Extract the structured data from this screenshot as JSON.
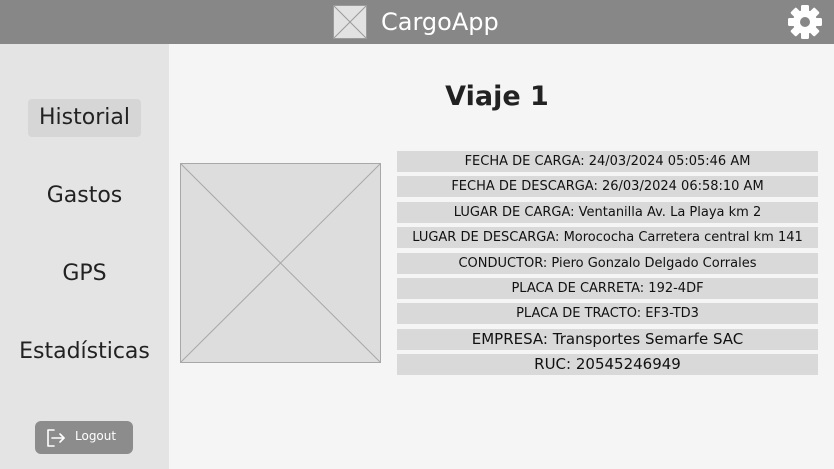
{
  "header": {
    "title": "CargoApp",
    "logo_icon": "image-placeholder-icon",
    "settings_icon": "gear-icon"
  },
  "sidebar": {
    "items": [
      {
        "label": "Historial",
        "active": true
      },
      {
        "label": "Gastos",
        "active": false
      },
      {
        "label": "GPS",
        "active": false
      },
      {
        "label": "Estadísticas",
        "active": false
      }
    ],
    "logout_label": "Logout",
    "logout_icon": "logout-icon"
  },
  "main": {
    "title": "Viaje 1",
    "image_icon": "image-placeholder-icon",
    "details": [
      "FECHA DE CARGA: 24/03/2024 05:05:46 AM",
      "FECHA DE DESCARGA: 26/03/2024 06:58:10 AM",
      "LUGAR DE CARGA: Ventanilla Av. La Playa km 2",
      "LUGAR DE DESCARGA: Morococha Carretera central km 141",
      "CONDUCTOR: Piero Gonzalo Delgado Corrales",
      "PLACA DE CARRETA: 192-4DF",
      "PLACA DE TRACTO: EF3-TD3",
      "EMPRESA: Transportes Semarfe SAC",
      "RUC: 20545246949"
    ]
  },
  "colors": {
    "topbar": "#878787",
    "sidebar": "#e4e4e4",
    "background": "#f5f5f5",
    "row": "#d9d9d9",
    "logout_button": "#8c8c8c"
  }
}
